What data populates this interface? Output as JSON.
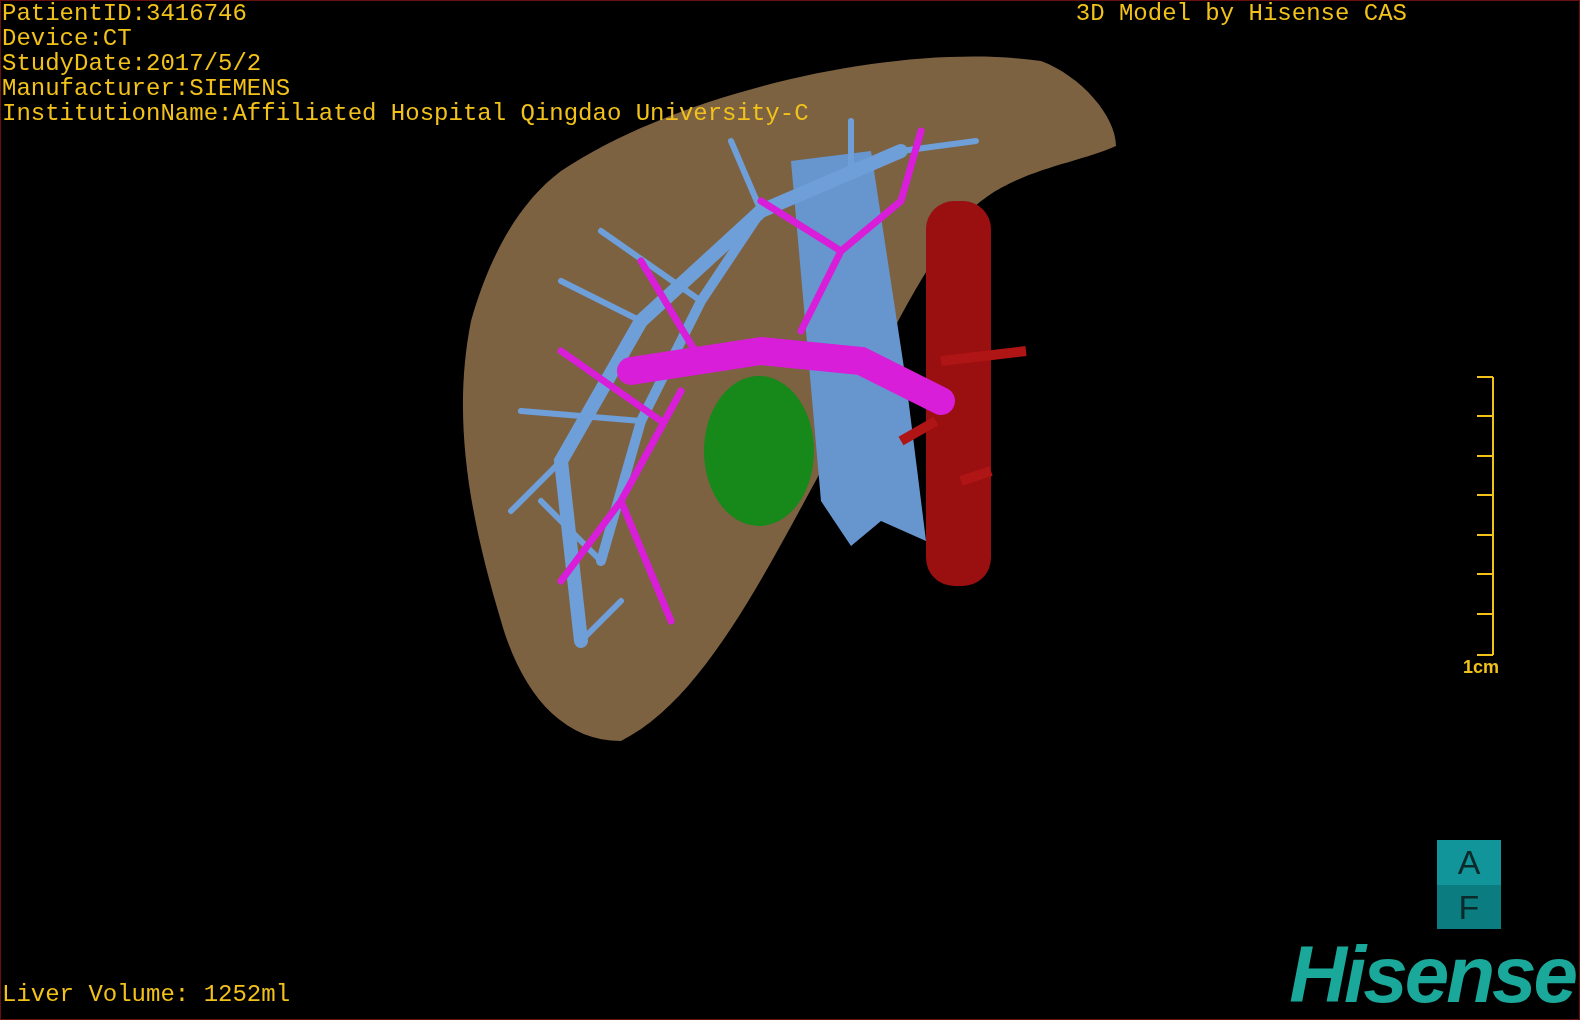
{
  "patient_info": [
    "PatientID:3416746",
    "Device:CT",
    "StudyDate:2017/5/2",
    "Manufacturer:SIEMENS",
    "InstitutionName:Affiliated Hospital Qingdao University-C"
  ],
  "title": "3D Model by Hisense CAS",
  "scale_bar": {
    "label": "1cm"
  },
  "orientation_cube": {
    "top": "A",
    "bottom": "F"
  },
  "liver_volume": "Liver Volume: 1252ml",
  "logo": "Hisense"
}
